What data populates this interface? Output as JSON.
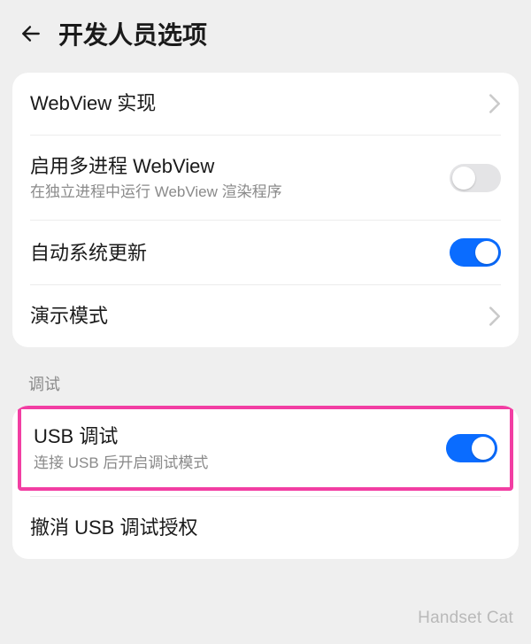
{
  "header": {
    "title": "开发人员选项"
  },
  "group1": {
    "webview_impl": {
      "title": "WebView 实现"
    },
    "multi_process_webview": {
      "title": "启用多进程 WebView",
      "subtitle": "在独立进程中运行 WebView 渲染程序",
      "enabled": false
    },
    "auto_system_update": {
      "title": "自动系统更新",
      "enabled": true
    },
    "demo_mode": {
      "title": "演示模式"
    }
  },
  "section_debug_label": "调试",
  "group2": {
    "usb_debugging": {
      "title": "USB 调试",
      "subtitle": "连接 USB 后开启调试模式",
      "enabled": true
    },
    "revoke_usb_auth": {
      "title": "撤消 USB 调试授权"
    }
  },
  "watermark": "Handset Cat"
}
